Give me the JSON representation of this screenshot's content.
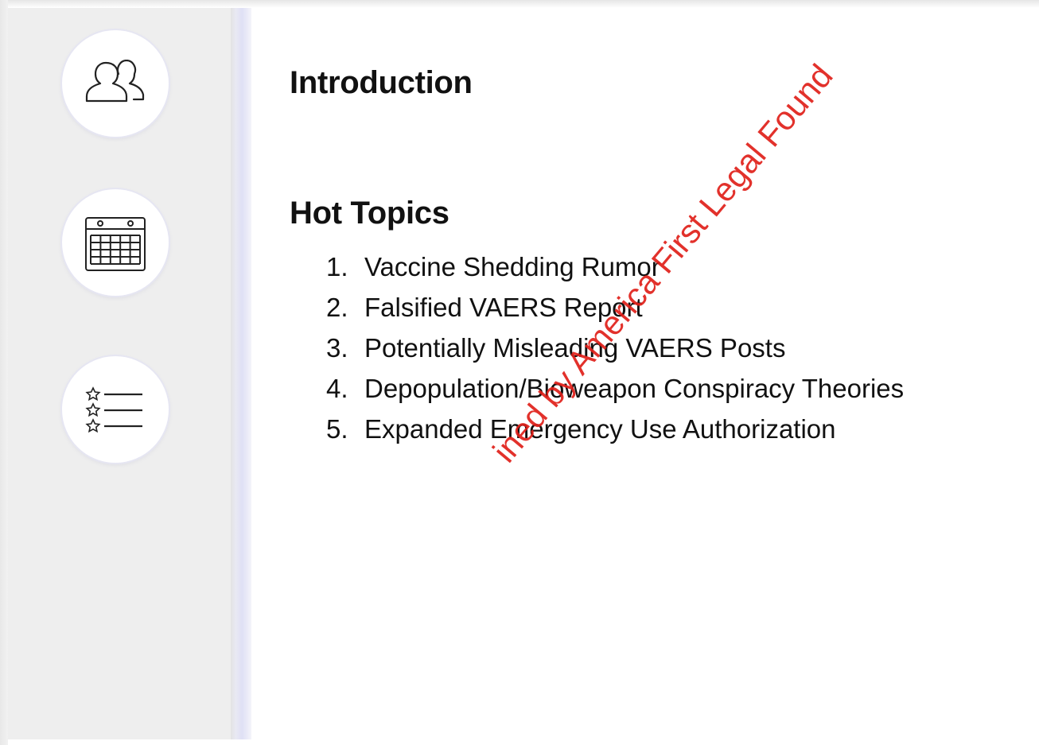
{
  "sidebar": {
    "icons": [
      {
        "name": "users-icon"
      },
      {
        "name": "calendar-icon"
      },
      {
        "name": "starred-list-icon"
      }
    ]
  },
  "main": {
    "intro_heading": "Introduction",
    "topics_heading": "Hot Topics",
    "topics": [
      {
        "num": "1.",
        "label": "Vaccine Shedding Rumor"
      },
      {
        "num": "2.",
        "label": "Falsified VAERS Report"
      },
      {
        "num": "3.",
        "label": "Potentially Misleading VAERS Posts"
      },
      {
        "num": "4.",
        "label": "Depopulation/Bioweapon Conspiracy Theories"
      },
      {
        "num": "5.",
        "label": "Expanded Emergency Use Authorization"
      }
    ]
  },
  "watermark": {
    "text": "ined by America First Legal Found",
    "color": "#e0201a"
  },
  "colors": {
    "sidebar_bg": "#eeeeee",
    "text": "#111111"
  }
}
